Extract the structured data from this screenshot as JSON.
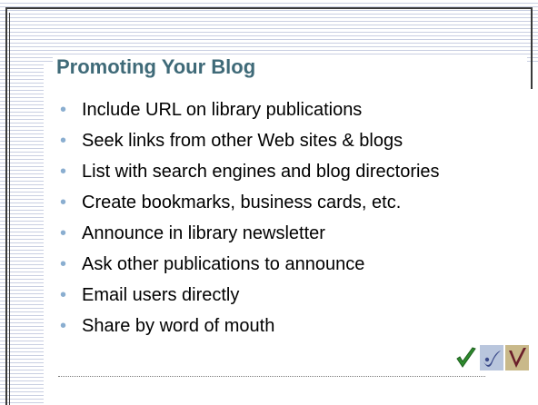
{
  "slide": {
    "title": "Promoting Your Blog",
    "bullets": [
      "Include URL on library publications",
      "Seek links from other Web sites & blogs",
      "List with search engines and blog directories",
      "Create bookmarks, business cards, etc.",
      "Announce in library newsletter",
      "Ask other publications to announce",
      "Email users directly",
      "Share by word of mouth"
    ],
    "bullet_glyph": "•",
    "colors": {
      "title": "#3f6a78",
      "bullet": "#8aaed0",
      "stripes": "#c9cfe2",
      "frame": "#3a3a3a"
    },
    "decor_icons": [
      "green-check-icon",
      "blue-check-icon",
      "gold-check-icon"
    ]
  }
}
